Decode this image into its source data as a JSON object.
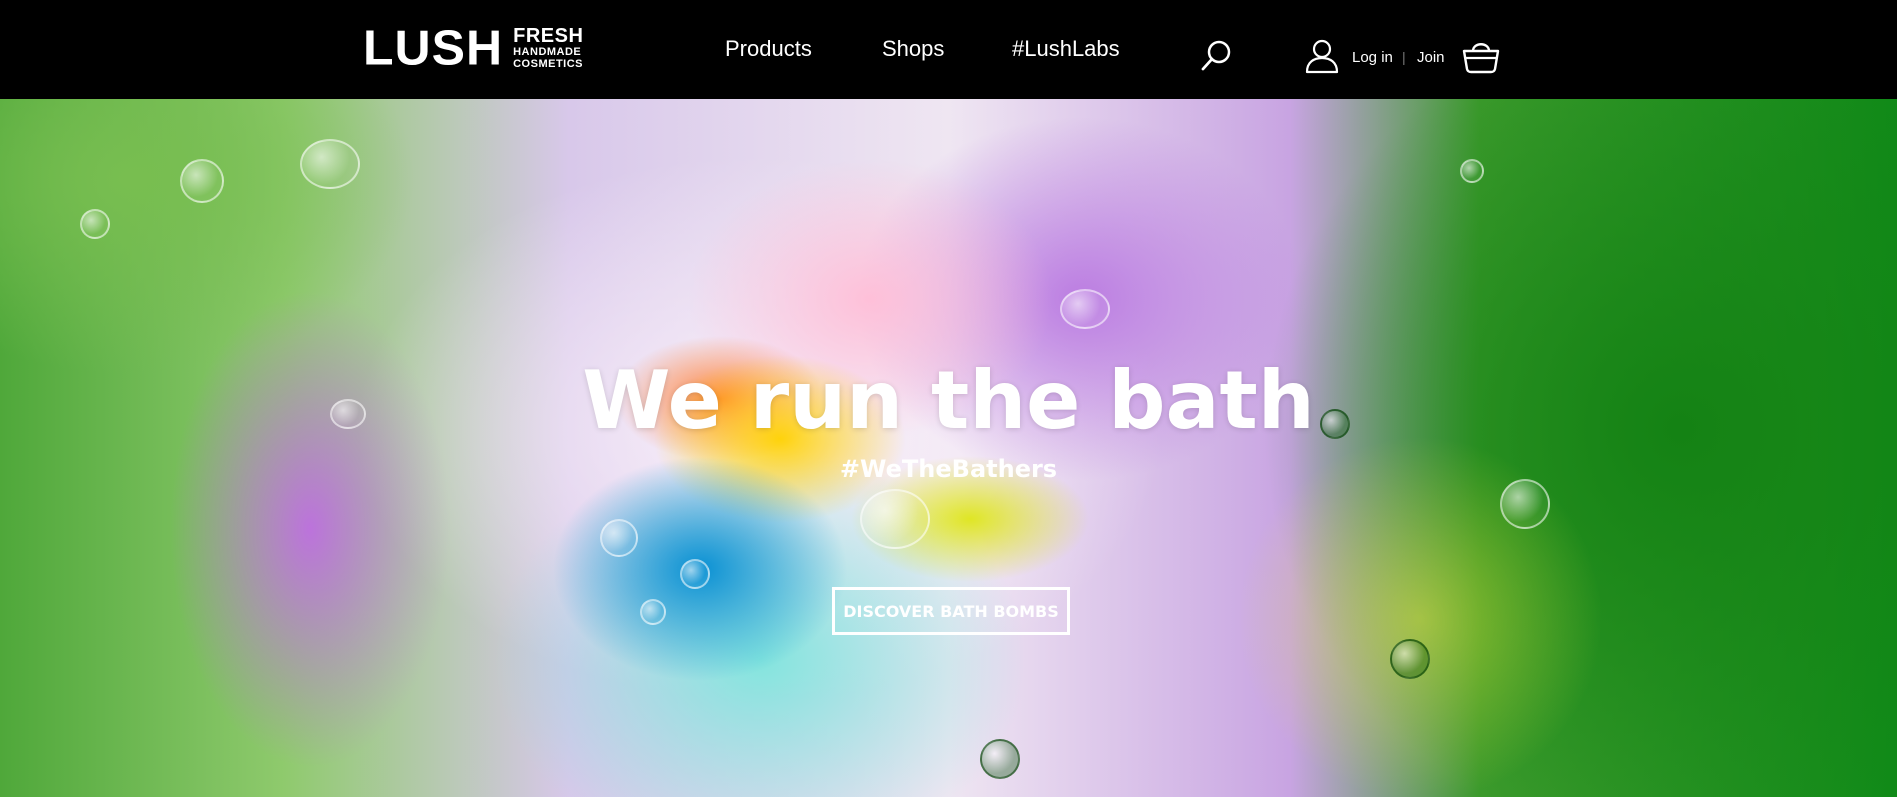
{
  "header": {
    "logo": {
      "wordmark": "LUSH",
      "tag_line1": "FRESH",
      "tag_line2": "HANDMADE",
      "tag_line3": "COSMETICS"
    },
    "nav": [
      {
        "label": "Products"
      },
      {
        "label": "Shops"
      },
      {
        "label": "#LushLabs"
      }
    ],
    "account": {
      "login_label": "Log in",
      "separator": "|",
      "join_label": "Join"
    },
    "icons": {
      "search": "search-icon",
      "user": "user-icon",
      "cart": "basket-icon"
    }
  },
  "hero": {
    "title": "We run the bath",
    "subtitle": "#WeTheBathers",
    "cta_label": "DISCOVER BATH BOMBS"
  },
  "colors": {
    "header_bg": "#000000",
    "text": "#ffffff",
    "separator": "#777777"
  }
}
